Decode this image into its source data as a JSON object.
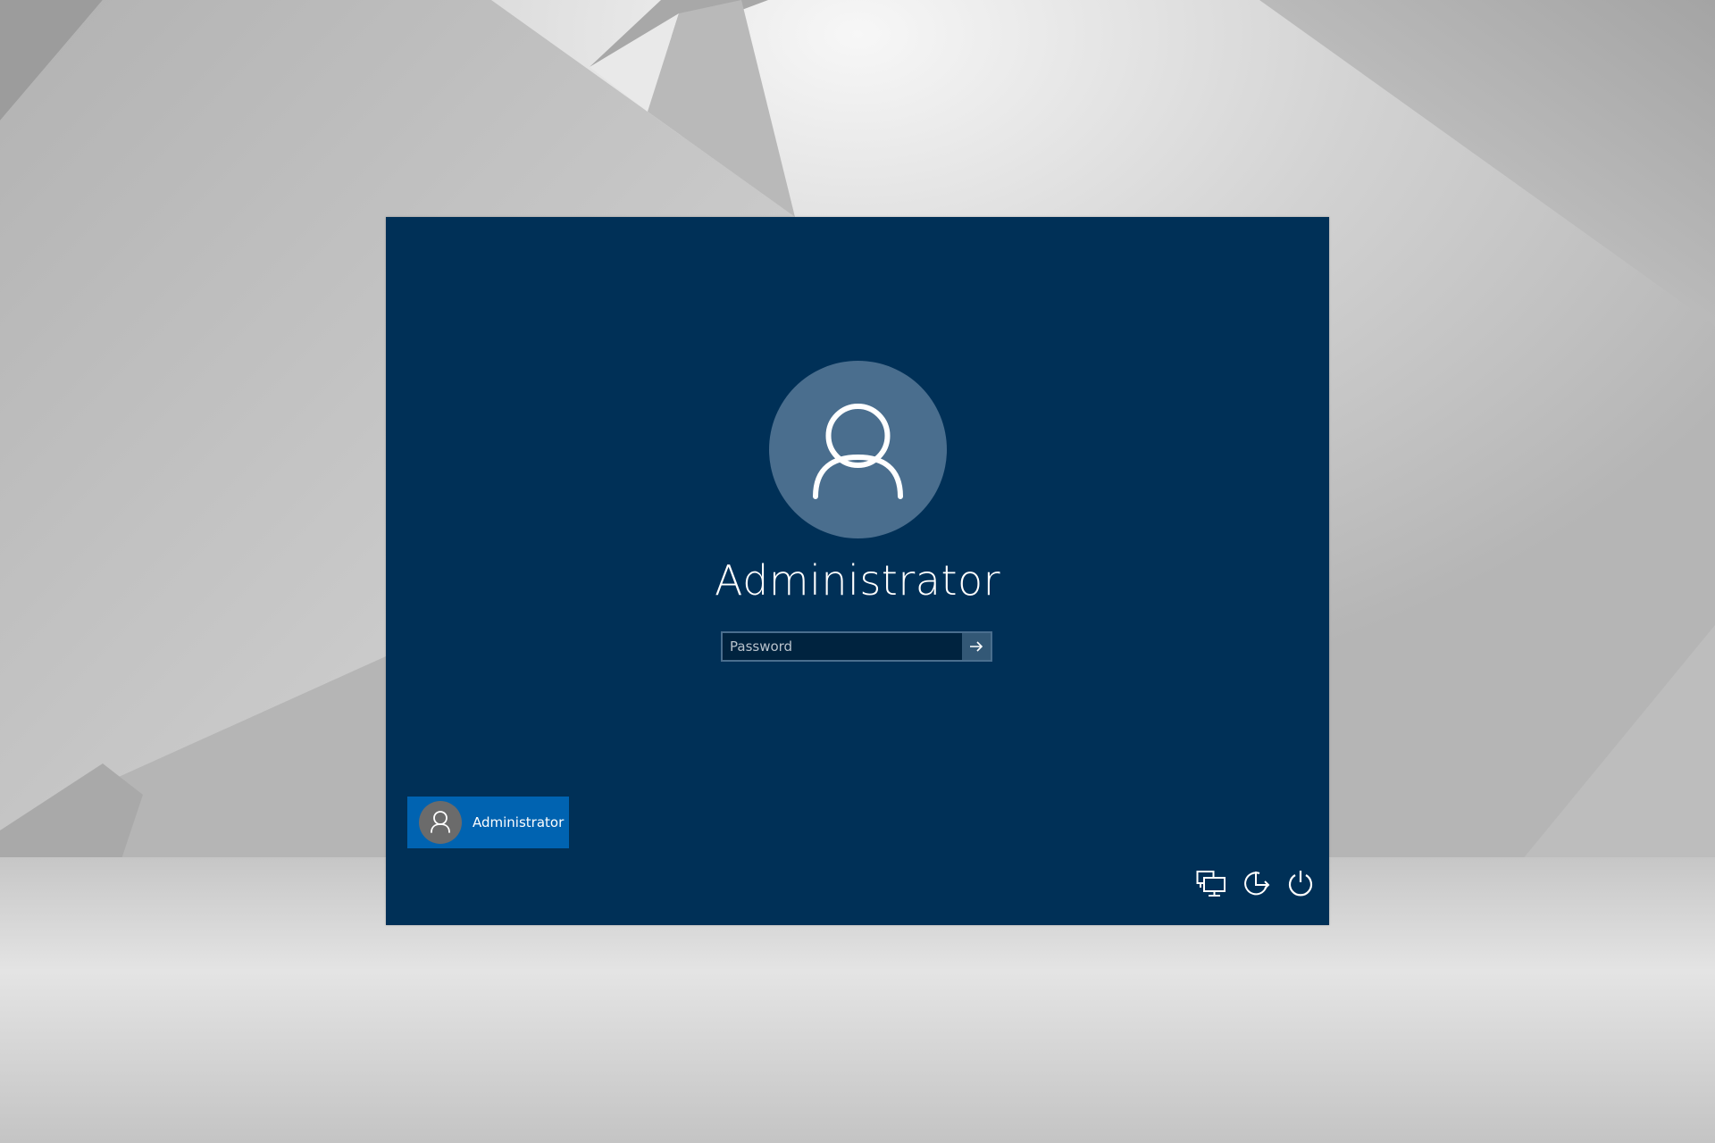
{
  "login_screen": {
    "user": {
      "display_name": "Administrator",
      "avatar_icon": "user-silhouette-icon"
    },
    "password": {
      "placeholder": "Password",
      "value": "",
      "submit_icon": "arrow-right-icon"
    },
    "user_tiles": [
      {
        "label": "Administrator",
        "icon": "user-silhouette-icon"
      }
    ],
    "tray": {
      "icons": [
        "network-icon",
        "ease-of-access-icon",
        "power-icon"
      ]
    }
  },
  "colors": {
    "screen_background": "#003057",
    "avatar_circle": "#4a6e8e",
    "tile_selected": "#0063b1",
    "input_background": "#00233f",
    "submit_button": "#335876"
  }
}
